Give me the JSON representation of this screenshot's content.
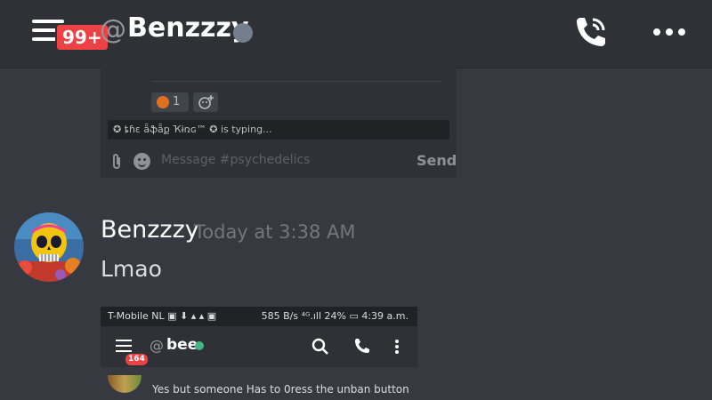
{
  "header": {
    "notification_badge": "99+",
    "at_symbol": "@",
    "title": "Benzzzy",
    "status": "offline",
    "icons": [
      "hamburger-menu-icon",
      "call-icon",
      "more-icon"
    ]
  },
  "embed": {
    "reaction_count": "1",
    "typing_text": "✪ ȶɦɛ ǟֆǟք Ҡɨռɢ™ ✪ is typing...",
    "input_placeholder": "Message #psychedelics",
    "send_label": "Send"
  },
  "message": {
    "author": "Benzzzy",
    "timestamp": "Today at 3:38 AM",
    "text": "Lmao"
  },
  "screenshot": {
    "status_left": "T-Mobile  NL ▣ ⬇ ▴ ▴ ▣",
    "status_right": "585 B/s ⁴ᴳ.ıll 24% ▭ 4:39 a.m.",
    "badge": "164",
    "at_symbol": "@",
    "title": "bee",
    "message_text": "Yes but someone Has to 0ress the unban button"
  },
  "colors": {
    "background": "#36393f",
    "header": "#2f3136",
    "badge_red": "#ed4245",
    "online_green": "#43b581",
    "offline_gray": "#747f8d"
  }
}
